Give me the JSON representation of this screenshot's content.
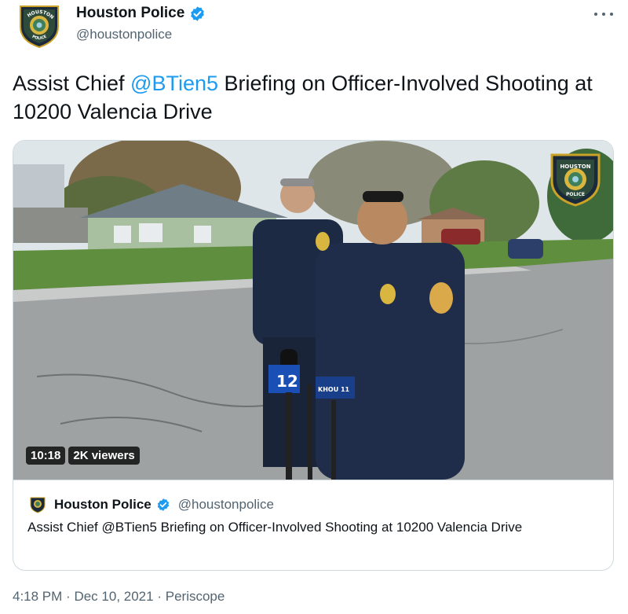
{
  "author": {
    "display_name": "Houston Police",
    "handle": "@houstonpolice",
    "badge_text": "HOUSTON POLICE"
  },
  "tweet": {
    "text_before": "Assist Chief ",
    "mention": "@BTien5",
    "text_after": " Briefing on Officer-Involved Shooting at 10200 Valencia Drive"
  },
  "media": {
    "duration": "10:18",
    "viewers": "2K viewers",
    "corner_logo_top": "HOUSTON",
    "corner_logo_bottom": "POLICE",
    "mic_label_1": "12",
    "mic_label_2": "KHOU 11"
  },
  "quote": {
    "display_name": "Houston Police",
    "handle": "@houstonpolice",
    "text": "Assist Chief @BTien5 Briefing on Officer-Involved Shooting at 10200 Valencia Drive"
  },
  "meta": {
    "time": "4:18 PM",
    "separator": "·",
    "date": "Dec 10, 2021",
    "source": "Periscope"
  },
  "colors": {
    "accent": "#1d9bf0",
    "text": "#0f1419",
    "secondary": "#536471",
    "border": "#cfd9de"
  }
}
